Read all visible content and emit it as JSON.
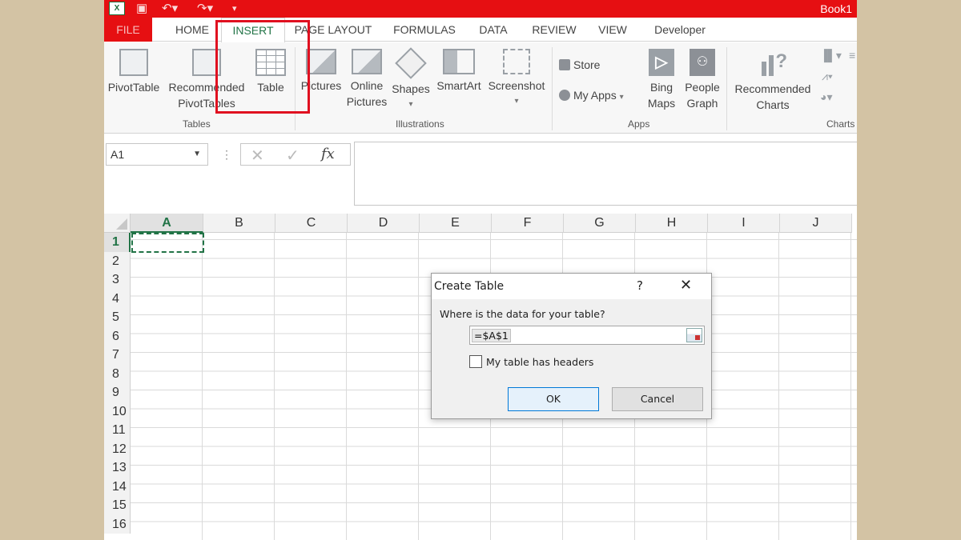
{
  "window": {
    "title": "Book1"
  },
  "quick_access": [
    "save-icon",
    "undo-icon",
    "redo-icon",
    "customize-icon"
  ],
  "tabs": [
    {
      "label": "FILE"
    },
    {
      "label": "HOME"
    },
    {
      "label": "INSERT"
    },
    {
      "label": "PAGE LAYOUT"
    },
    {
      "label": "FORMULAS"
    },
    {
      "label": "DATA"
    },
    {
      "label": "REVIEW"
    },
    {
      "label": "VIEW"
    },
    {
      "label": "Developer"
    }
  ],
  "ribbon": {
    "tables": {
      "group_label": "Tables",
      "pivottable": "PivotTable",
      "recommended_1": "Recommended",
      "recommended_2": "PivotTables",
      "table": "Table"
    },
    "illustrations": {
      "group_label": "Illustrations",
      "pictures": "Pictures",
      "online_1": "Online",
      "online_2": "Pictures",
      "shapes": "Shapes",
      "smartart": "SmartArt",
      "screenshot": "Screenshot"
    },
    "apps": {
      "group_label": "Apps",
      "store": "Store",
      "myapps": "My Apps",
      "bing_1": "Bing",
      "bing_2": "Maps",
      "people_1": "People",
      "people_2": "Graph"
    },
    "charts": {
      "group_label": "Charts",
      "rec_1": "Recommended",
      "rec_2": "Charts"
    }
  },
  "formula_bar": {
    "name_box": "A1",
    "fx": "fx",
    "cancel": "✕",
    "enter": "✓"
  },
  "columns": [
    "A",
    "B",
    "C",
    "D",
    "E",
    "F",
    "G",
    "H",
    "I",
    "J"
  ],
  "rows": [
    "1",
    "2",
    "3",
    "4",
    "5",
    "6",
    "7",
    "8",
    "9",
    "10",
    "11",
    "12",
    "13",
    "14",
    "15",
    "16"
  ],
  "dialog": {
    "title": "Create Table",
    "help": "?",
    "close": "✕",
    "question": "Where is the data for your table?",
    "range": "=$A$1",
    "checkbox_label": "My table has headers",
    "checkbox_checked": false,
    "ok": "OK",
    "cancel": "Cancel"
  }
}
